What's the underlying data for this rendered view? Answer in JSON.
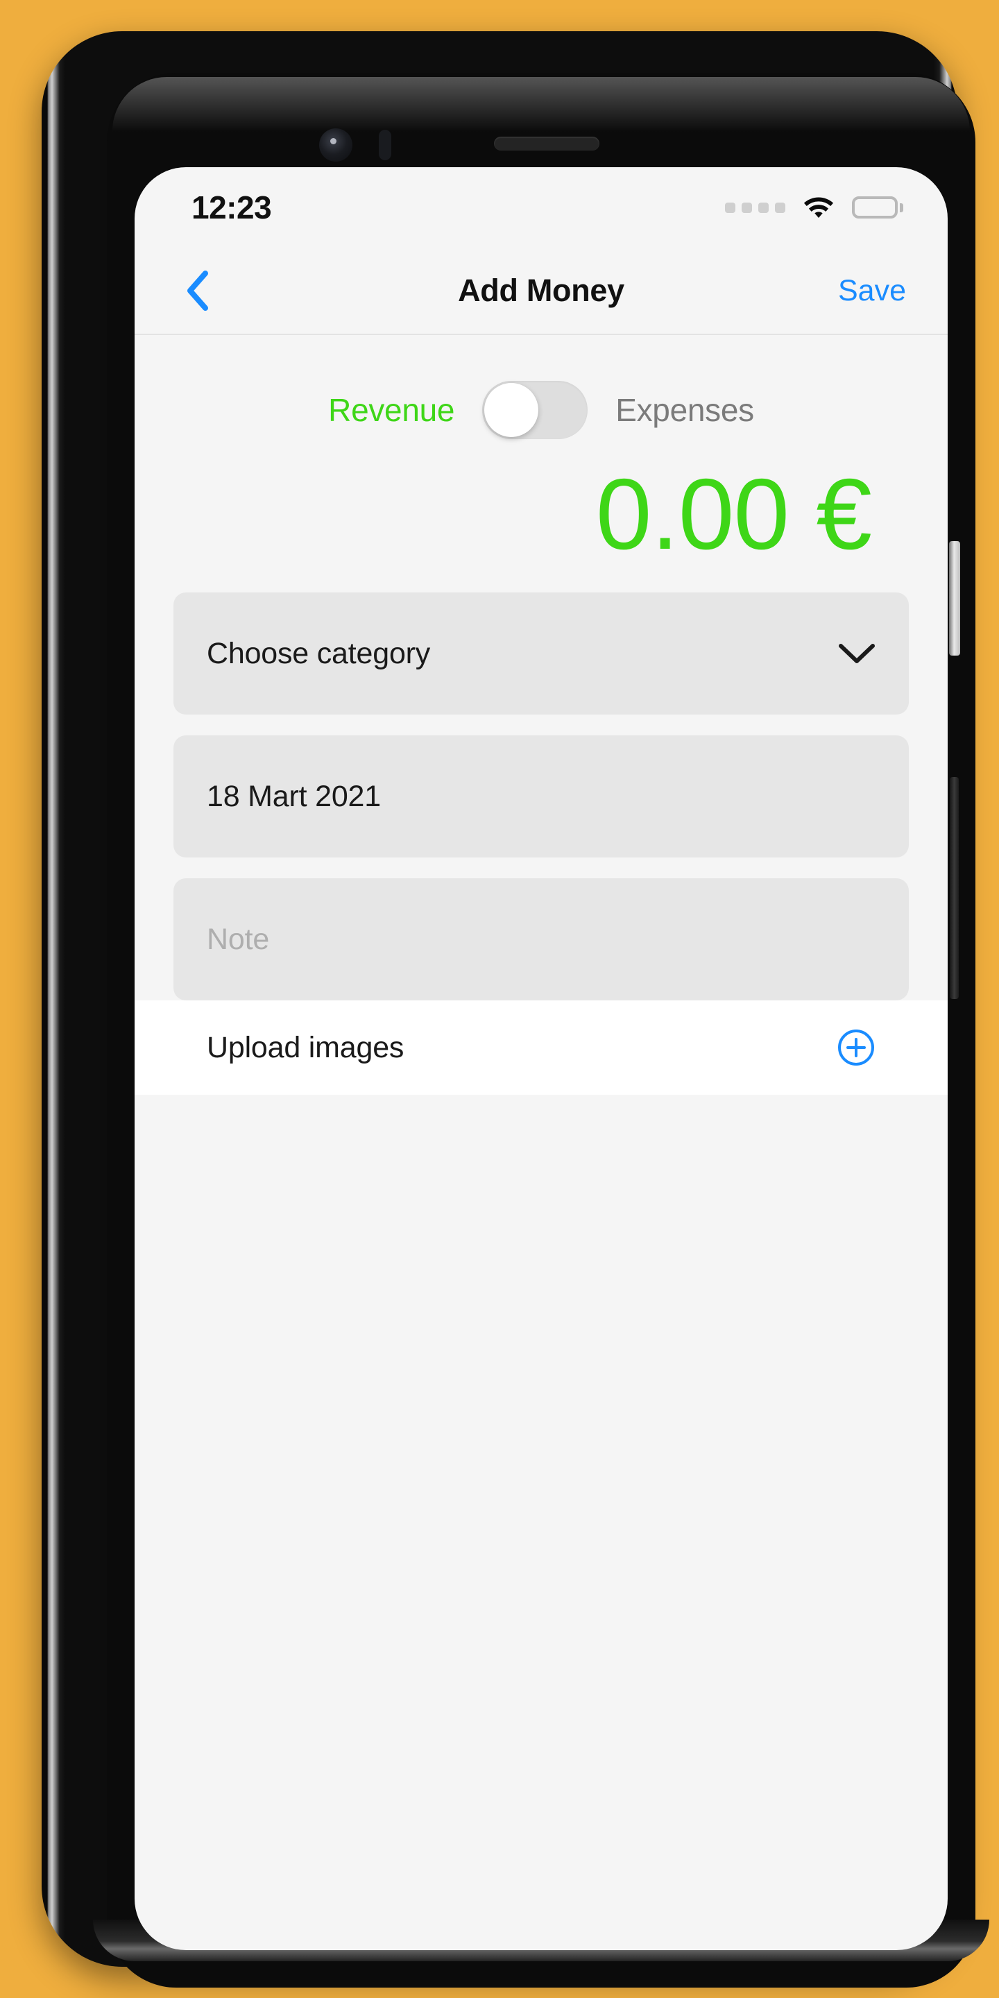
{
  "theme": {
    "background": "#EFAE3E",
    "accent_blue": "#1A8CFF",
    "accent_green": "#3ED617",
    "screen_bg": "#F5F5F5",
    "field_bg": "#E6E6E6"
  },
  "status_bar": {
    "time": "12:23",
    "signal_icon": "signal-dots-icon",
    "wifi_icon": "wifi-icon",
    "battery_icon": "battery-full-icon"
  },
  "nav": {
    "back_icon": "chevron-left-icon",
    "title": "Add Money",
    "save_label": "Save"
  },
  "type_toggle": {
    "revenue_label": "Revenue",
    "expenses_label": "Expenses",
    "selected": "Revenue",
    "knob_position": "left"
  },
  "amount": {
    "value": "0.00 €"
  },
  "fields": {
    "category": {
      "label": "Choose category",
      "chevron_icon": "chevron-down-icon"
    },
    "date": {
      "value": "18 Mart 2021"
    },
    "note": {
      "placeholder": "Note",
      "value": ""
    }
  },
  "upload": {
    "label": "Upload images",
    "add_icon": "plus-circle-icon"
  },
  "device": {
    "earpiece": "earpiece-speaker",
    "front_camera": "front-camera",
    "volume_button": "volume-button",
    "power_button": "power-button"
  }
}
